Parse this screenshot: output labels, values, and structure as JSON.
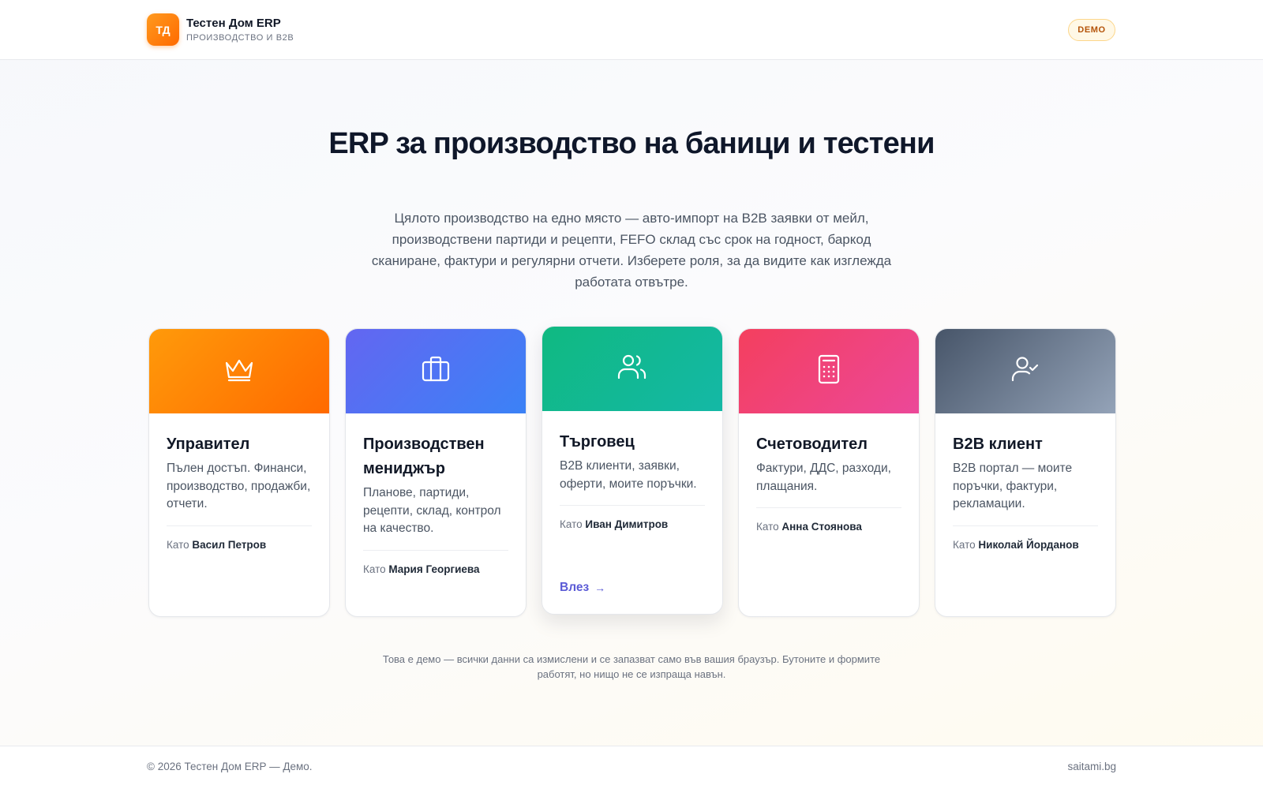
{
  "header": {
    "logo_text": "ТД",
    "app_name": "Тестен Дом ERP",
    "app_subtitle": "ПРОИЗВОДСТВО И B2B",
    "badge": "DEMO"
  },
  "hero": {
    "title": "ERP за производство на баници и тестени",
    "subtitle": "Цялото производство на едно място — авто-импорт на B2B заявки от мейл, производствени партиди и рецепти, FEFO склад със срок на годност, баркод сканиране, фактури и регулярни отчети. Изберете роля, за да видите как изглежда работата отвътре."
  },
  "cards": [
    {
      "title": "Управител",
      "description": "Пълен достъп. Финанси, производство, продажби, отчети.",
      "as_prefix": "Като",
      "person": "Васил Петров",
      "icon": "crown-icon",
      "colors": [
        "#ff9a0a",
        "#ff6a00"
      ]
    },
    {
      "title": "Производствен мениджър",
      "description": "Планове, партиди, рецепти, склад, контрол на качество.",
      "as_prefix": "Като",
      "person": "Мария Георгиева",
      "icon": "briefcase-icon",
      "colors": [
        "#6366f1",
        "#3b82f6"
      ]
    },
    {
      "title": "Търговец",
      "description": "B2B клиенти, заявки, оферти, моите поръчки.",
      "as_prefix": "Като",
      "person": "Иван Димитров",
      "icon": "users-icon",
      "colors": [
        "#10b981",
        "#14b8a6"
      ],
      "enter_label": "Влез"
    },
    {
      "title": "Счетоводител",
      "description": "Фактури, ДДС, разходи, плащания.",
      "as_prefix": "Като",
      "person": "Анна Стоянова",
      "icon": "calculator-icon",
      "colors": [
        "#f43f5e",
        "#ec4899"
      ]
    },
    {
      "title": "B2B клиент",
      "description": "B2B портал — моите поръчки, фактури, рекламации.",
      "as_prefix": "Като",
      "person": "Николай Йорданов",
      "icon": "user-check-icon",
      "colors": [
        "#475569",
        "#94a3b8"
      ]
    }
  ],
  "note": "Това е демо — всички данни са измислени и се запазват само във вашия браузър. Бутоните и формите работят, но нищо не се изпраща навън.",
  "footer": {
    "copyright": "© 2026 Тестен Дом ERP — Демо.",
    "link": "saitami.bg"
  }
}
